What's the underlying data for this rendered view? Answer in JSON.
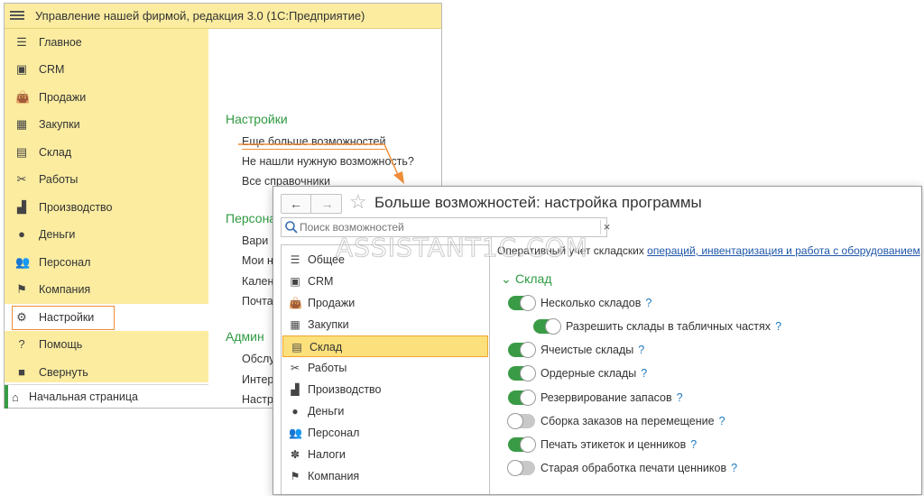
{
  "app": {
    "title": "Управление нашей фирмой, редакция 3.0  (1С:Предприятие)"
  },
  "sidebar": {
    "items": [
      {
        "label": "Главное",
        "icon": "list-icon"
      },
      {
        "label": "CRM",
        "icon": "crm-card-icon"
      },
      {
        "label": "Продажи",
        "icon": "shopping-bag-icon"
      },
      {
        "label": "Закупки",
        "icon": "cart-icon"
      },
      {
        "label": "Склад",
        "icon": "warehouse-grid-icon"
      },
      {
        "label": "Работы",
        "icon": "tools-icon"
      },
      {
        "label": "Производство",
        "icon": "factory-icon"
      },
      {
        "label": "Деньги",
        "icon": "ruble-coin-icon"
      },
      {
        "label": "Персонал",
        "icon": "people-icon"
      },
      {
        "label": "Компания",
        "icon": "flag-icon"
      },
      {
        "label": "Настройки",
        "icon": "gear-icon"
      },
      {
        "label": "Помощь",
        "icon": "help-icon"
      },
      {
        "label": "Свернуть",
        "icon": "collapse-icon"
      }
    ],
    "active": "Настройки",
    "home_label": "Начальная страница"
  },
  "content": {
    "settings_title": "Настройки",
    "settings_links": [
      "Еще больше возможностей",
      "Не нашли нужную возможность?",
      "Все справочники"
    ],
    "personal_title": "Персона",
    "personal_links": [
      "Вари",
      "Мои н",
      "Кален",
      "Почта"
    ],
    "admin_title": "Админ",
    "admin_links": [
      "Обслу",
      "Интер",
      "Настр"
    ]
  },
  "dialog": {
    "title": "Больше возможностей: настройка программы",
    "search_placeholder": "Поиск возможностей",
    "clear_glyph": "×",
    "categories": [
      {
        "label": "Общее",
        "icon": "list-icon"
      },
      {
        "label": "CRM",
        "icon": "crm-card-icon"
      },
      {
        "label": "Продажи",
        "icon": "shopping-bag-icon"
      },
      {
        "label": "Закупки",
        "icon": "cart-icon"
      },
      {
        "label": "Склад",
        "icon": "warehouse-grid-icon"
      },
      {
        "label": "Работы",
        "icon": "tools-icon"
      },
      {
        "label": "Производство",
        "icon": "factory-icon"
      },
      {
        "label": "Деньги",
        "icon": "ruble-coin-icon"
      },
      {
        "label": "Персонал",
        "icon": "people-icon"
      },
      {
        "label": "Налоги",
        "icon": "emblem-icon"
      },
      {
        "label": "Компания",
        "icon": "flag-icon"
      }
    ],
    "selected_category": "Склад",
    "description_prefix": "Оперативный учет складских ",
    "description_link": "операций, инвентаризация и работа с оборудованием",
    "description_suffix": ".",
    "section_title": "Склад",
    "help_glyph": "?",
    "options": [
      {
        "label": "Несколько складов",
        "enabled": true,
        "nested": false
      },
      {
        "label": "Разрешить склады в табличных частях",
        "enabled": true,
        "nested": true
      },
      {
        "label": "Ячеистые склады",
        "enabled": true,
        "nested": false
      },
      {
        "label": "Ордерные склады",
        "enabled": true,
        "nested": false
      },
      {
        "label": "Резервирование запасов",
        "enabled": true,
        "nested": false
      },
      {
        "label": "Сборка заказов на перемещение",
        "enabled": false,
        "nested": false
      },
      {
        "label": "Печать этикеток и ценников",
        "enabled": true,
        "nested": false
      },
      {
        "label": "Старая обработка печати ценников",
        "enabled": false,
        "nested": false
      }
    ]
  },
  "watermark": "ASSISTANT1C.COM",
  "colors": {
    "sidebar_bg": "#fbeca0",
    "accent_green": "#3a9b46",
    "highlight_orange": "#f08d37",
    "selected_bg": "#fbe07b",
    "link_blue": "#1f56a8"
  }
}
